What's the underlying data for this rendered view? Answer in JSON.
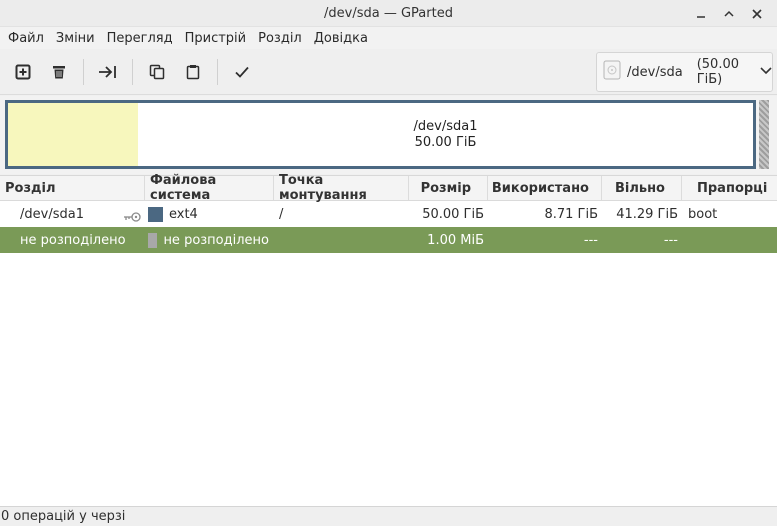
{
  "window": {
    "title": "/dev/sda — GParted"
  },
  "menu": {
    "items": [
      "Файл",
      "Зміни",
      "Перегляд",
      "Пристрій",
      "Розділ",
      "Довідка"
    ]
  },
  "toolbar": {
    "buttons": [
      "new-icon",
      "delete-icon",
      "resize-move-icon",
      "copy-icon",
      "paste-icon",
      "apply-icon"
    ],
    "device": {
      "name": "/dev/sda",
      "size": "(50.00 ГіБ)"
    }
  },
  "diskmap": {
    "partition_name": "/dev/sda1",
    "partition_size": "50.00 ГіБ"
  },
  "table": {
    "headers": [
      "Розділ",
      "Файлова система",
      "Точка монтування",
      "Розмір",
      "Використано",
      "Вільно",
      "Прапорці"
    ],
    "rows": [
      {
        "partition": "/dev/sda1",
        "filesystem": "ext4",
        "fs_color": "#4b6882",
        "mount": "/",
        "size": "50.00 ГіБ",
        "used": "8.71 ГіБ",
        "free": "41.29 ГіБ",
        "flags": "boot"
      },
      {
        "partition": "не розподілено",
        "filesystem": "не розподілено",
        "fs_color": "#a8a8a8",
        "mount": "",
        "size": "1.00 МіБ",
        "used": "---",
        "free": "---",
        "flags": ""
      }
    ]
  },
  "status": {
    "text": "0 операцій у черзі"
  },
  "colors": {
    "accent": "#4b6882",
    "selection": "#7a9a57",
    "unallocated": "#f7f7bd"
  }
}
